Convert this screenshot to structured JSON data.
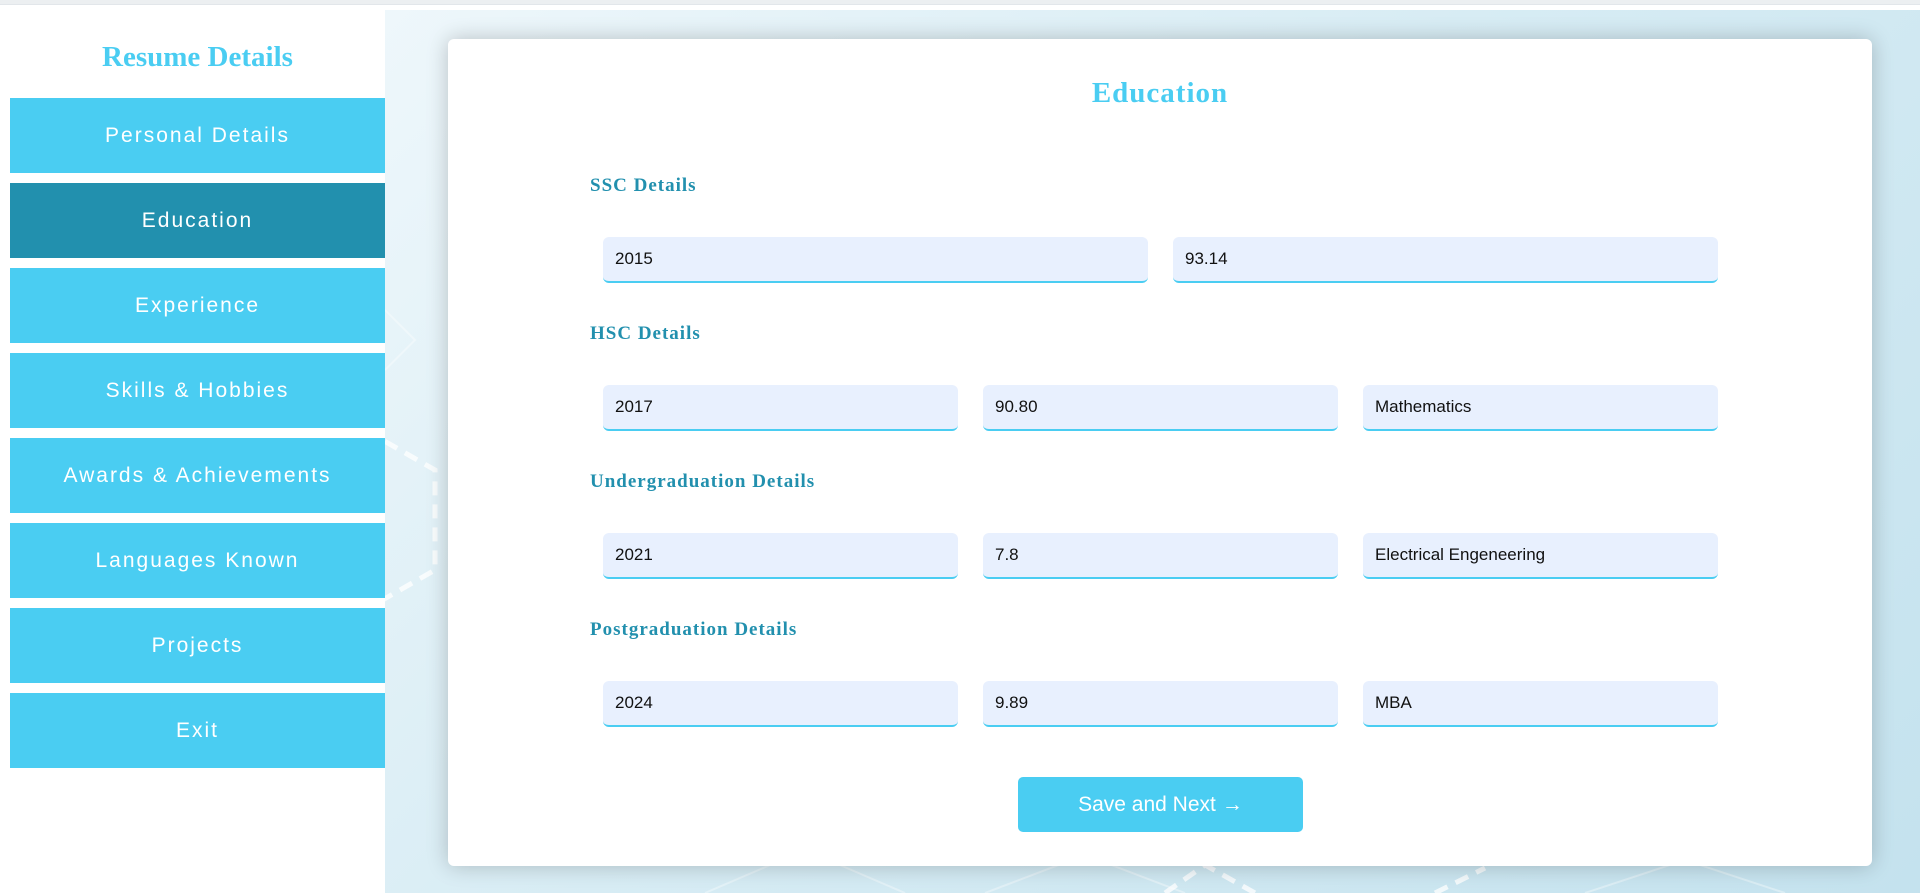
{
  "sidebar": {
    "title": "Resume Details",
    "items": [
      {
        "label": "Personal Details",
        "active": false
      },
      {
        "label": "Education",
        "active": true
      },
      {
        "label": "Experience",
        "active": false
      },
      {
        "label": "Skills & Hobbies",
        "active": false
      },
      {
        "label": "Awards & Achievements",
        "active": false
      },
      {
        "label": "Languages Known",
        "active": false
      },
      {
        "label": "Projects",
        "active": false
      },
      {
        "label": "Exit",
        "active": false
      }
    ]
  },
  "form": {
    "title": "Education",
    "sections": {
      "ssc": {
        "label": "SSC Details",
        "year": "2015",
        "score": "93.14"
      },
      "hsc": {
        "label": "HSC Details",
        "year": "2017",
        "score": "90.80",
        "stream": "Mathematics"
      },
      "ug": {
        "label": "Undergraduation Details",
        "year": "2021",
        "score": "7.8",
        "stream": "Electrical Engeneering"
      },
      "pg": {
        "label": "Postgraduation Details",
        "year": "2024",
        "score": "9.89",
        "stream": "MBA"
      }
    },
    "save_label": "Save and Next",
    "save_arrow": "→"
  },
  "colors": {
    "accent": "#4acdf2",
    "accent_dark": "#2290ae",
    "field_bg": "#e8f0fe"
  },
  "icons": {
    "save_arrow": "arrow-right-icon"
  }
}
